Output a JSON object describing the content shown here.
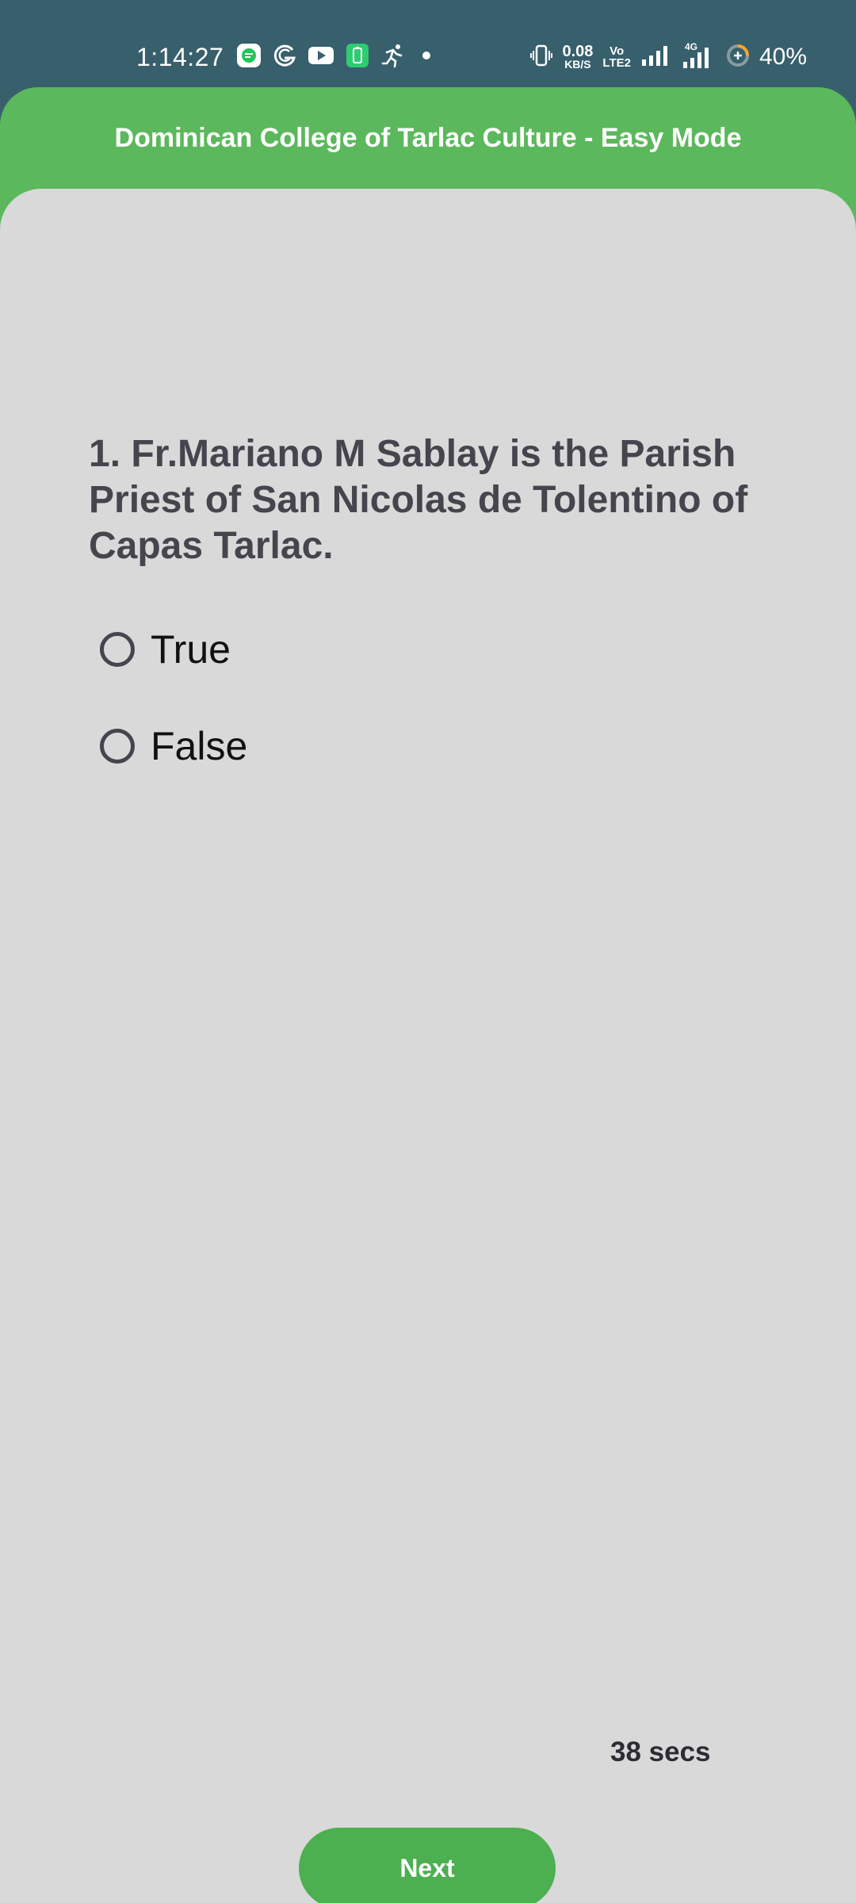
{
  "status_bar": {
    "time": "1:14:27",
    "net_speed_value": "0.08",
    "net_speed_unit": "KB/S",
    "volte_top": "Vo",
    "volte_bottom": "LTE2",
    "network_label": "4G",
    "battery_percent": "40%",
    "icons_left": [
      "message-icon",
      "g-icon",
      "youtube-icon",
      "battery-saver-icon",
      "running-icon",
      "dot-icon"
    ],
    "icons_right": [
      "vibrate-icon",
      "signal-icon",
      "signal-4g-icon",
      "battery-icon"
    ]
  },
  "header": {
    "title": "Dominican College of Tarlac Culture - Easy Mode",
    "color": "#5cb85c"
  },
  "quiz": {
    "question": "1. Fr.Mariano M Sablay is the Parish Priest of San Nicolas de Tolentino of Capas Tarlac.",
    "options": [
      {
        "label": "True",
        "selected": false
      },
      {
        "label": "False",
        "selected": false
      }
    ],
    "timer": "38 secs",
    "next_label": "Next"
  },
  "colors": {
    "status_bar": "#375f6c",
    "accent": "#5cb85c",
    "button": "#4caf50",
    "card_background": "#d9d9d9",
    "question_text": "#46454e"
  }
}
